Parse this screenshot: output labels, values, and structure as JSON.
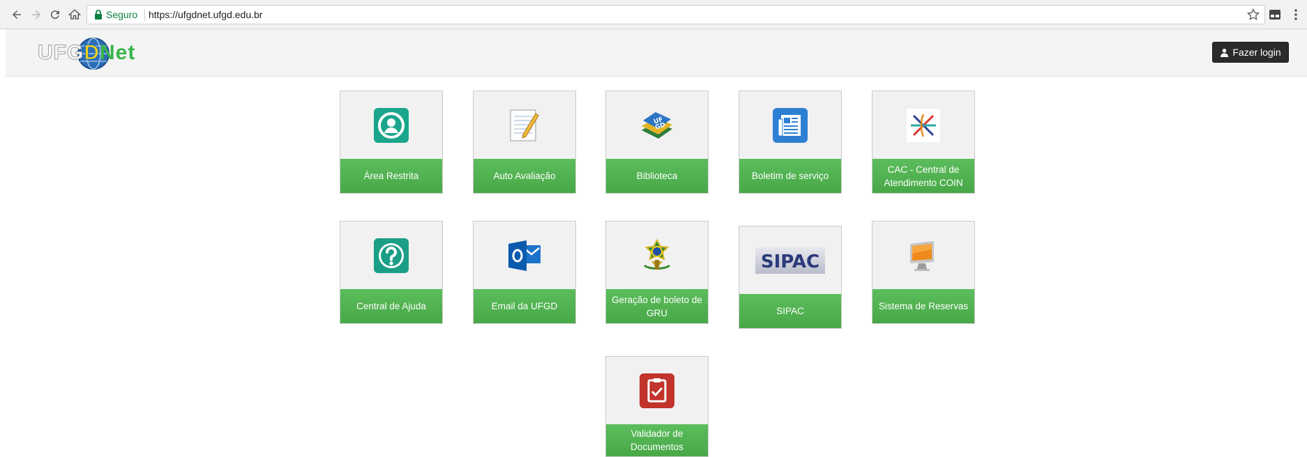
{
  "browser": {
    "secure_label": "Seguro",
    "url": "https://ufgdnet.ufgd.edu.br"
  },
  "header": {
    "logo": {
      "part1": "UFG",
      "part2": "D",
      "part3": "Net"
    },
    "login_label": "Fazer login"
  },
  "tiles": [
    {
      "label": "Área Restrita",
      "icon": "user-circle-icon"
    },
    {
      "label": "Auto Avaliação",
      "icon": "notepad-pencil-icon"
    },
    {
      "label": "Biblioteca",
      "icon": "books-icon"
    },
    {
      "label": "Boletim de serviço",
      "icon": "newspaper-icon"
    },
    {
      "label": "CAC - Central de Atendimento COIN",
      "icon": "cac-logo-icon"
    },
    {
      "label": "Central de Ajuda",
      "icon": "help-icon"
    },
    {
      "label": "Email da UFGD",
      "icon": "outlook-icon"
    },
    {
      "label": "Geração de boleto de GRU",
      "icon": "brazil-coat-of-arms-icon"
    },
    {
      "label": "SIPAC",
      "icon": "sipac-logo-icon",
      "logo_text": "SIPAC"
    },
    {
      "label": "Sistema de Reservas",
      "icon": "monitor-icon"
    },
    {
      "label": "Validador de Documentos",
      "icon": "clipboard-check-icon"
    }
  ],
  "colors": {
    "tile_green": "#4cae4c",
    "login_bg": "#2b2b2b",
    "secure_green": "#0b8043"
  }
}
